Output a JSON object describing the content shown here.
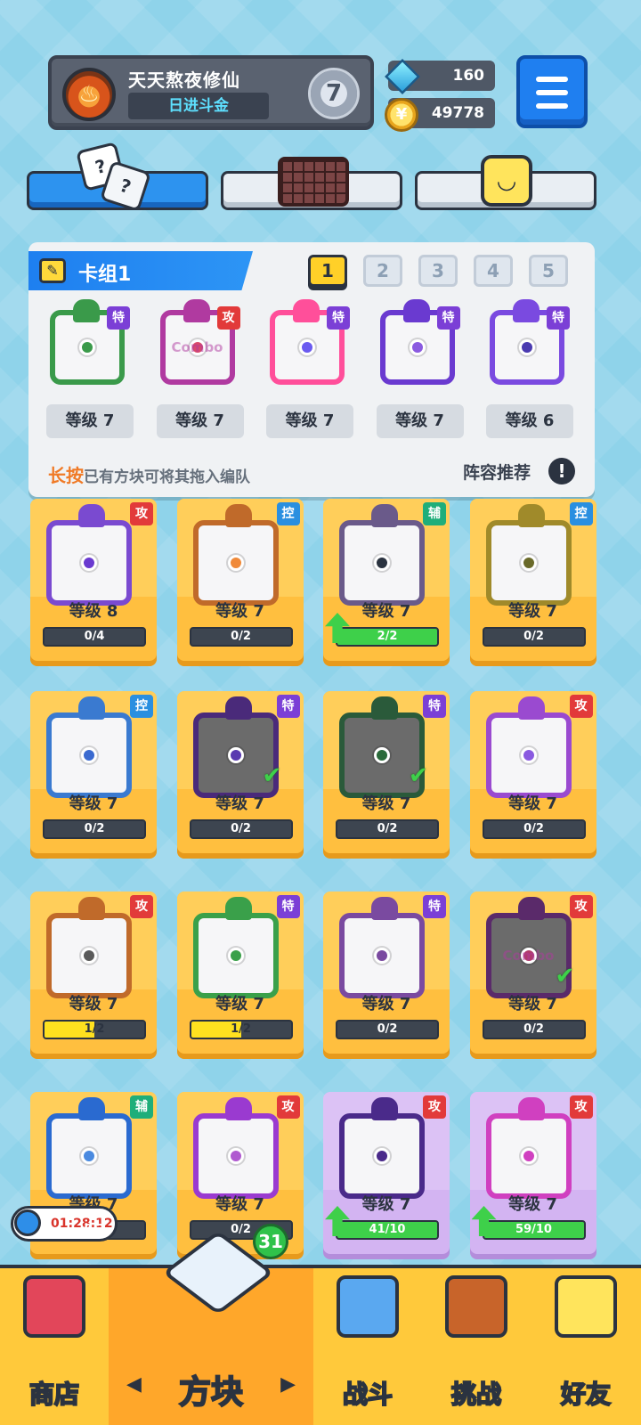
{
  "profile": {
    "name": "天天熬夜修仙",
    "title": "日进斗金",
    "rank": "7",
    "avatar_icon": "fire-icon"
  },
  "currency": {
    "gems": "160",
    "coins": "49778",
    "gem_icon": "gem-icon",
    "coin_icon": "coin-icon"
  },
  "categories": [
    {
      "icon": "dice-icon",
      "active": true
    },
    {
      "icon": "board-icon",
      "active": false
    },
    {
      "icon": "emote-icon",
      "active": false
    }
  ],
  "deck": {
    "name": "卡组1",
    "tabs": [
      "1",
      "2",
      "3",
      "4",
      "5"
    ],
    "active_tab": "1",
    "dice": [
      {
        "tag": "特",
        "level": "等级 7",
        "frame": "#3a9a4a",
        "pip": "#3a9a4a"
      },
      {
        "tag": "攻",
        "level": "等级 7",
        "frame": "#b03aa0",
        "pip": "#d94a6a",
        "face_text": "Combo"
      },
      {
        "tag": "特",
        "level": "等级 7",
        "frame": "#ff4f9a",
        "pip": "#6a5af0"
      },
      {
        "tag": "特",
        "level": "等级 7",
        "frame": "#6a3ad0",
        "pip": "#8a5ae0"
      },
      {
        "tag": "特",
        "level": "等级 6",
        "frame": "#7a4ae0",
        "pip": "#4a3ab0"
      }
    ],
    "hint_highlight": "长按",
    "hint_text": "已有方块可将其拖入编队",
    "recommend_label": "阵容推荐",
    "info_icon": "!"
  },
  "collection": [
    {
      "tag": "攻",
      "level": "等级 8",
      "progress": "0/4",
      "fill": 0,
      "frame": "#7a4ad0",
      "pip": "#6a3ad0"
    },
    {
      "tag": "控",
      "level": "等级 7",
      "progress": "0/2",
      "fill": 0,
      "frame": "#c06a2a",
      "pip": "#f08a3a"
    },
    {
      "tag": "辅",
      "level": "等级 7",
      "progress": "2/2",
      "fill": 1.0,
      "fill_color": "green",
      "upgrade": true,
      "frame": "#6a5a8a",
      "pip": "#2b3340"
    },
    {
      "tag": "控",
      "level": "等级 7",
      "progress": "0/2",
      "fill": 0,
      "frame": "#a08a2a",
      "pip": "#6a6a2a"
    },
    {
      "tag": "控",
      "level": "等级 7",
      "progress": "0/2",
      "fill": 0,
      "frame": "#3a7ad0",
      "pip": "#3a6ad0"
    },
    {
      "tag": "特",
      "level": "等级 7",
      "progress": "0/2",
      "fill": 0,
      "frame": "#4a2a7a",
      "pip": "#5a3ab0",
      "dark": true,
      "equipped": true
    },
    {
      "tag": "特",
      "level": "等级 7",
      "progress": "0/2",
      "fill": 0,
      "frame": "#2a5a3a",
      "pip": "#2a6a3a",
      "dark": true,
      "equipped": true
    },
    {
      "tag": "攻",
      "level": "等级 7",
      "progress": "0/2",
      "fill": 0,
      "frame": "#9a4ad0",
      "pip": "#8a5ae0"
    },
    {
      "tag": "攻",
      "level": "等级 7",
      "progress": "1/2",
      "fill": 0.5,
      "fill_color": "yellow",
      "frame": "#c06a2a",
      "pip": "#5a5a5a"
    },
    {
      "tag": "特",
      "level": "等级 7",
      "progress": "1/2",
      "fill": 0.5,
      "fill_color": "yellow",
      "frame": "#3aa04a",
      "pip": "#3aa04a"
    },
    {
      "tag": "特",
      "level": "等级 7",
      "progress": "0/2",
      "fill": 0,
      "frame": "#7a4aa0",
      "pip": "#7a4aa0"
    },
    {
      "tag": "攻",
      "level": "等级 7",
      "progress": "0/2",
      "fill": 0,
      "frame": "#5a2a6a",
      "pip": "#b03a6a",
      "dark": true,
      "equipped": true,
      "face_text": "Combo"
    },
    {
      "tag": "辅",
      "level": "等级 7",
      "progress": "0/2",
      "fill": 0,
      "frame": "#2a6ad0",
      "pip": "#4a8ae0"
    },
    {
      "tag": "攻",
      "level": "等级 7",
      "progress": "0/2",
      "fill": 0,
      "frame": "#9a3ad0",
      "pip": "#b05ad0"
    },
    {
      "tag": "攻",
      "level": "等级 7",
      "progress": "41/10",
      "fill": 1.0,
      "fill_color": "green",
      "upgrade": true,
      "purple": true,
      "frame": "#4a2a8a",
      "pip": "#4a2a8a"
    },
    {
      "tag": "攻",
      "level": "等级 7",
      "progress": "59/10",
      "fill": 1.0,
      "fill_color": "green",
      "upgrade": true,
      "purple": true,
      "frame": "#d040c0",
      "pip": "#d040c0"
    }
  ],
  "timer": "01:28:12",
  "nav": {
    "shop": "商店",
    "dice": "方块",
    "battle": "战斗",
    "challenge": "挑战",
    "friends": "好友",
    "dice_badge": "31"
  },
  "colors": {
    "accent_blue": "#1f7ff0",
    "card_orange": "#ffbf3f",
    "nav_yellow": "#ffc93b",
    "progress_green": "#3ed04a"
  }
}
